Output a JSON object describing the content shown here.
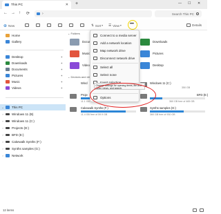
{
  "window": {
    "title": "This PC"
  },
  "titlebar": {
    "new_tab": "+",
    "tab_close": "✕",
    "min": "—",
    "max": "☐",
    "close": "✕"
  },
  "nav": {
    "back": "←",
    "forward": "→",
    "up": "↑",
    "refresh": "⟳",
    "address_chevron": "›",
    "search_placeholder": "Search This PC"
  },
  "command_bar": {
    "new_label": "New",
    "sort_label": "Sort",
    "view_label": "View",
    "more_label": "•••",
    "details_label": "Details"
  },
  "sidebar": {
    "items": [
      {
        "label": "Home",
        "icon": "home-icon",
        "color": "#e8a23a"
      },
      {
        "label": "Gallery",
        "icon": "gallery-icon",
        "color": "#3a86d8"
      },
      {
        "label": "Desktop",
        "icon": "desktop-icon",
        "color": "#3a86d8"
      },
      {
        "label": "Downloads",
        "icon": "download-icon",
        "color": "#2b8a3e"
      },
      {
        "label": "Documents",
        "icon": "documents-icon",
        "color": "#6b7c8f"
      },
      {
        "label": "Pictures",
        "icon": "pictures-icon",
        "color": "#3a86d8"
      },
      {
        "label": "Music",
        "icon": "music-icon",
        "color": "#e2553d"
      },
      {
        "label": "Videos",
        "icon": "videos-icon",
        "color": "#8a4ad8"
      },
      {
        "label": "This PC",
        "icon": "this-pc-icon",
        "color": "#3a86d8"
      },
      {
        "label": "Windows 11 (B)",
        "icon": "drive-icon",
        "color": "#444444"
      },
      {
        "label": "Windows 11 (C:)",
        "icon": "drive-icon",
        "color": "#444444"
      },
      {
        "label": "Projects (D:)",
        "icon": "drive-icon",
        "color": "#444444"
      },
      {
        "label": "BFD (E:)",
        "icon": "drive-icon",
        "color": "#444444"
      },
      {
        "label": "Cakewalk Synths (F:)",
        "icon": "drive-icon",
        "color": "#444444"
      },
      {
        "label": "Synths samples (G:)",
        "icon": "drive-icon",
        "color": "#444444"
      },
      {
        "label": "Network",
        "icon": "network-icon",
        "color": "#3a86d8"
      }
    ]
  },
  "content": {
    "folders_header": "Folders",
    "folders": [
      {
        "label": "Documents",
        "color": "#8a9bb0"
      },
      {
        "label": "Downloads",
        "color": "#2b8a3e"
      },
      {
        "label": "Music",
        "color": "#e2553d"
      },
      {
        "label": "Pictures",
        "color": "#3a86d8"
      },
      {
        "label": "Videos",
        "color": "#8a4ad8"
      },
      {
        "label": "Desktop",
        "color": "#3a86d8"
      }
    ],
    "devices_header": "Devices and drives",
    "drives": [
      {
        "name": "Wind",
        "free": "",
        "fill": 0.5
      },
      {
        "name": "Windows 11 (C:)",
        "free": "350 GB",
        "fill": 0.55
      },
      {
        "name": "Proje",
        "free": "",
        "fill": 0.8
      },
      {
        "name": "BFD (E:)",
        "free": "",
        "fill": 0.6
      },
      {
        "name": "11.1 GB free of 465 GB",
        "free": "",
        "fill": 0.97
      },
      {
        "name": "",
        "free": "360 GB free of 465 GB",
        "fill": 0.23
      },
      {
        "name": "Cakewalk Synths (F:)",
        "free": "11.4 GB free of 59.9 GB",
        "fill": 0.81
      },
      {
        "name": "Synths samples (G:)",
        "free": "360 GB free of 930 GB",
        "fill": 0.61
      }
    ]
  },
  "menu": {
    "items": [
      {
        "label": "Connect to a media server",
        "icon": "media-server-icon"
      },
      {
        "label": "Add a network location",
        "icon": "network-location-icon"
      },
      {
        "label": "Map network drive",
        "icon": "map-drive-icon"
      },
      {
        "label": "Disconnect network drive",
        "icon": "disconnect-drive-icon"
      },
      {
        "label": "Select all",
        "icon": "select-all-icon"
      },
      {
        "label": "Select none",
        "icon": "select-none-icon"
      },
      {
        "label": "Invert selection",
        "icon": "invert-selection-icon"
      },
      {
        "label": "Options",
        "icon": "options-icon"
      }
    ]
  },
  "tooltip": "Change settings for opening items, file and folder views, and search.",
  "status": {
    "count": "12 items"
  },
  "colors": {
    "accent": "#0067c0",
    "highlight_yellow": "#f2d400",
    "annotation_red": "#e21c1c",
    "selection": "#cce4f7"
  }
}
